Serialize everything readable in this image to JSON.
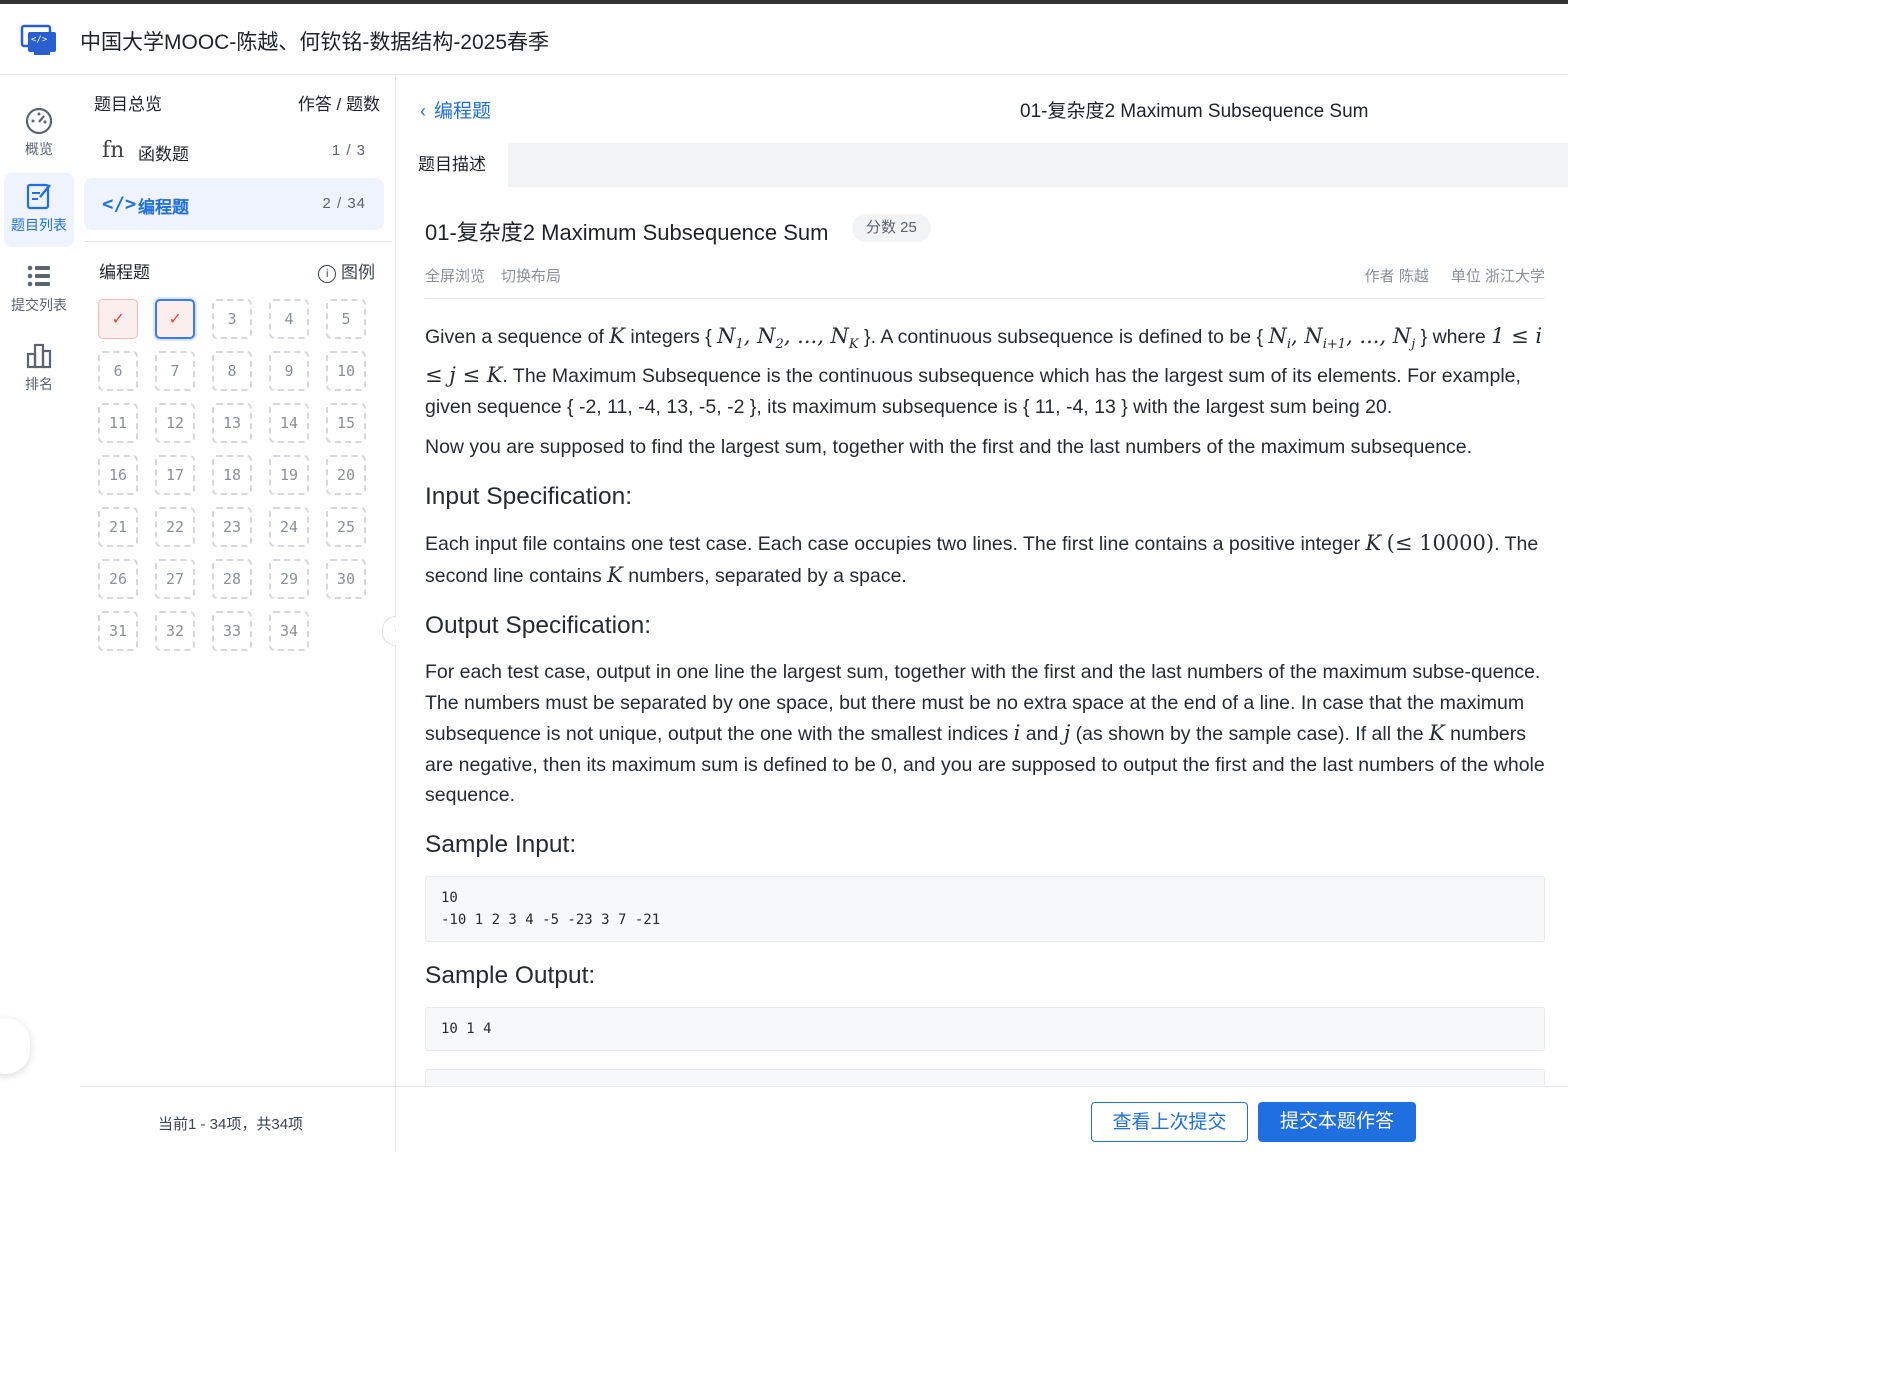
{
  "header": {
    "title": "中国大学MOOC-陈越、何钦铭-数据结构-2025春季"
  },
  "nav": [
    {
      "label": "概览",
      "icon": "dashboard-icon"
    },
    {
      "label": "题目列表",
      "icon": "edit-list-icon"
    },
    {
      "label": "提交列表",
      "icon": "list-icon"
    },
    {
      "label": "排名",
      "icon": "ranking-icon"
    }
  ],
  "overview": {
    "title": "题目总览",
    "right": "作答 / 题数",
    "types": [
      {
        "label": "函数题",
        "count": "1 / 3",
        "icon": "function-icon"
      },
      {
        "label": "编程题",
        "count": "2 / 34",
        "icon": "code-icon"
      }
    ],
    "section": "编程题",
    "legend": "图例",
    "cells": [
      "✓",
      "✓",
      "3",
      "4",
      "5",
      "6",
      "7",
      "8",
      "9",
      "10",
      "11",
      "12",
      "13",
      "14",
      "15",
      "16",
      "17",
      "18",
      "19",
      "20",
      "21",
      "22",
      "23",
      "24",
      "25",
      "26",
      "27",
      "28",
      "29",
      "30",
      "31",
      "32",
      "33",
      "34"
    ],
    "pager": "当前1 - 34项，共34项"
  },
  "main": {
    "back": "编程题",
    "header_title": "01-复杂度2 Maximum Subsequence Sum",
    "tab": "题目描述",
    "problem_title": "01-复杂度2 Maximum Subsequence Sum",
    "score": "分数 25",
    "tool_fullscreen": "全屏浏览",
    "tool_layout": "切换布局",
    "author": "作者 陈越",
    "unit": "单位 浙江大学",
    "h_input": "Input Specification:",
    "h_output": "Output Specification:",
    "h_sample_in": "Sample Input:",
    "h_sample_out": "Sample Output:",
    "sample_input": "10\n-10 1 2 3 4 -5 -23 3 7 -21",
    "sample_output": "10 1 4",
    "p1a": "Given a sequence of ",
    "p1b": " integers { ",
    "p1c": " }. A continuous subsequence is defined to be { ",
    "p1d": " } where ",
    "p1e": ". The Maximum Subsequence is the continuous subsequence which has the largest sum of its elements. For example, given sequence { -2, 11, -4, 13, -5, -2 }, its maximum subsequence is { 11, -4, 13 } with the largest sum being 20.",
    "p2": "Now you are supposed to find the largest sum, together with the first and the last numbers of the maximum subsequence.",
    "in_a": "Each input file contains one test case. Each case occupies two lines. The first line contains a positive integer ",
    "in_b": ". The second line contains ",
    "in_c": " numbers, separated by a space.",
    "out_a": "For each test case, output in one line the largest sum, together with the first and the last numbers of the maximum subse-quence. The numbers must be separated by one space, but there must be no extra space at the end of a line. In case that the maximum subsequence is not unique, output the one with the smallest indices ",
    "out_b": " and ",
    "out_c": " (as shown by the sample case). If all the ",
    "out_d": " numbers are negative, then its maximum sum is defined to be 0, and you are supposed to output the first and the last numbers of the whole sequence.",
    "math_K": "K",
    "math_i": "i",
    "math_j": "j",
    "math_seq": "N₁, N₂, ..., N_K",
    "math_sub": "Nᵢ, Nᵢ₊₁, ..., Nⱼ",
    "math_cond": "1 ≤ i ≤ j ≤ K",
    "math_limit": "(≤ 10000)"
  },
  "footer": {
    "view_last": "查看上次提交",
    "submit": "提交本题作答"
  },
  "colors": {
    "accent": "#1f6fe0",
    "done_bg": "#fdeeee",
    "done_mark": "#e0453b"
  }
}
